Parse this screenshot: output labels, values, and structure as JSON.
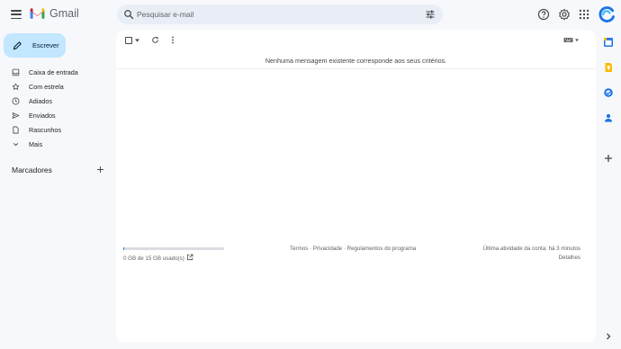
{
  "header": {
    "app_name": "Gmail",
    "search_placeholder": "Pesquisar e-mail"
  },
  "nav": {
    "compose_label": "Escrever",
    "items": [
      {
        "label": "Caixa de entrada",
        "icon": "inbox-icon"
      },
      {
        "label": "Com estrela",
        "icon": "star-icon"
      },
      {
        "label": "Adiados",
        "icon": "clock-icon"
      },
      {
        "label": "Enviados",
        "icon": "send-icon"
      },
      {
        "label": "Rascunhos",
        "icon": "draft-icon"
      },
      {
        "label": "Mais",
        "icon": "chevron-down-icon"
      }
    ],
    "labels_title": "Marcadores"
  },
  "main": {
    "empty_message": "Nenhuma mensagem existente corresponde aos seus critérios.",
    "storage_text": "0 GB de 15 GB usado(s)",
    "storage_fraction": 0.01,
    "footer_links": "Termos · Privacidade · Regulamentos do programa",
    "last_activity": "Última atividade da conta: há 3 minutos",
    "details_label": "Detalhes"
  },
  "colors": {
    "background": "#f6f8fc",
    "compose": "#c2e7ff",
    "search": "#e9eef6",
    "accent": "#1a73e8"
  }
}
